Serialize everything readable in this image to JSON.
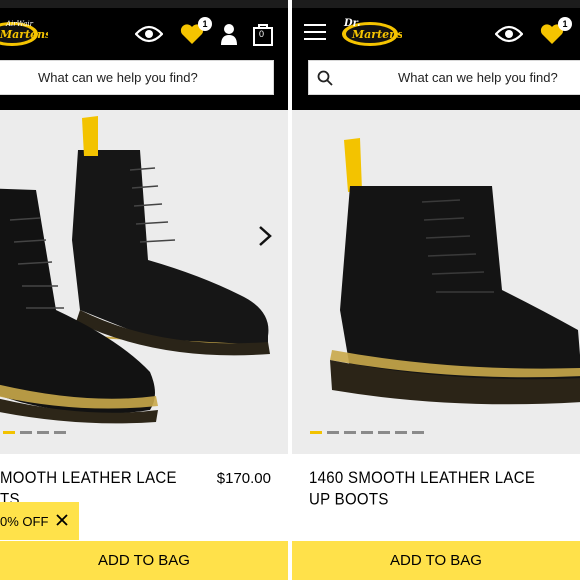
{
  "brand": {
    "logo_text_line1": "Dr.",
    "logo_text_line2": "Martens",
    "logo_tagline": "AirWair"
  },
  "left": {
    "cart_badge": "1",
    "bag_count": "0",
    "search_placeholder": "What can we help you find?",
    "product_name_line1": "MOOTH LEATHER LACE",
    "product_name_line2": "TS",
    "price": "$170.00",
    "promo_text": "0% OFF",
    "add_to_bag": "ADD TO BAG"
  },
  "right": {
    "cart_badge": "1",
    "search_placeholder": "What can we help you find?",
    "product_name_line1": "1460 SMOOTH LEATHER LACE",
    "product_name_line2": "UP BOOTS",
    "add_to_bag": "ADD TO BAG"
  },
  "colors": {
    "accent_yellow": "#ffe14a",
    "header_black": "#000000",
    "dot_active": "#f2c200"
  },
  "icons": [
    "eye-icon",
    "heart-icon",
    "user-icon",
    "bag-icon",
    "menu-icon",
    "search-icon",
    "close-icon",
    "chevron-right-icon"
  ]
}
